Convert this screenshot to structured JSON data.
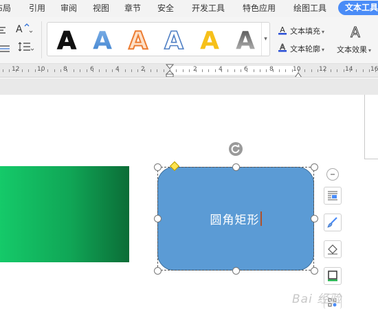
{
  "menu": {
    "tabs": [
      "布局",
      "引用",
      "审阅",
      "视图",
      "章节",
      "安全",
      "开发工具",
      "特色应用",
      "绘图工具",
      "文本工具"
    ],
    "active_tab": "文本工具"
  },
  "ribbon": {
    "gallery_sample": "A",
    "text_fill_label": "文本填充",
    "text_outline_label": "文本轮廓",
    "text_effect_label": "文本效果"
  },
  "ruler": {
    "labels": [
      "12",
      "10",
      "8",
      "6",
      "4",
      "2",
      "2",
      "4",
      "6",
      "8",
      "10",
      "12",
      "14",
      "16"
    ]
  },
  "document": {
    "shape_text": "圆角矩形"
  },
  "watermark": {
    "text": "Bai 经验"
  },
  "colors": {
    "accent_tab": "#4a8cf7",
    "rounded_rect_fill": "#5b9bd5",
    "green_gradient_start": "#15cb6a",
    "green_gradient_end": "#0b6d37",
    "adjust_handle": "#ffe34f"
  }
}
